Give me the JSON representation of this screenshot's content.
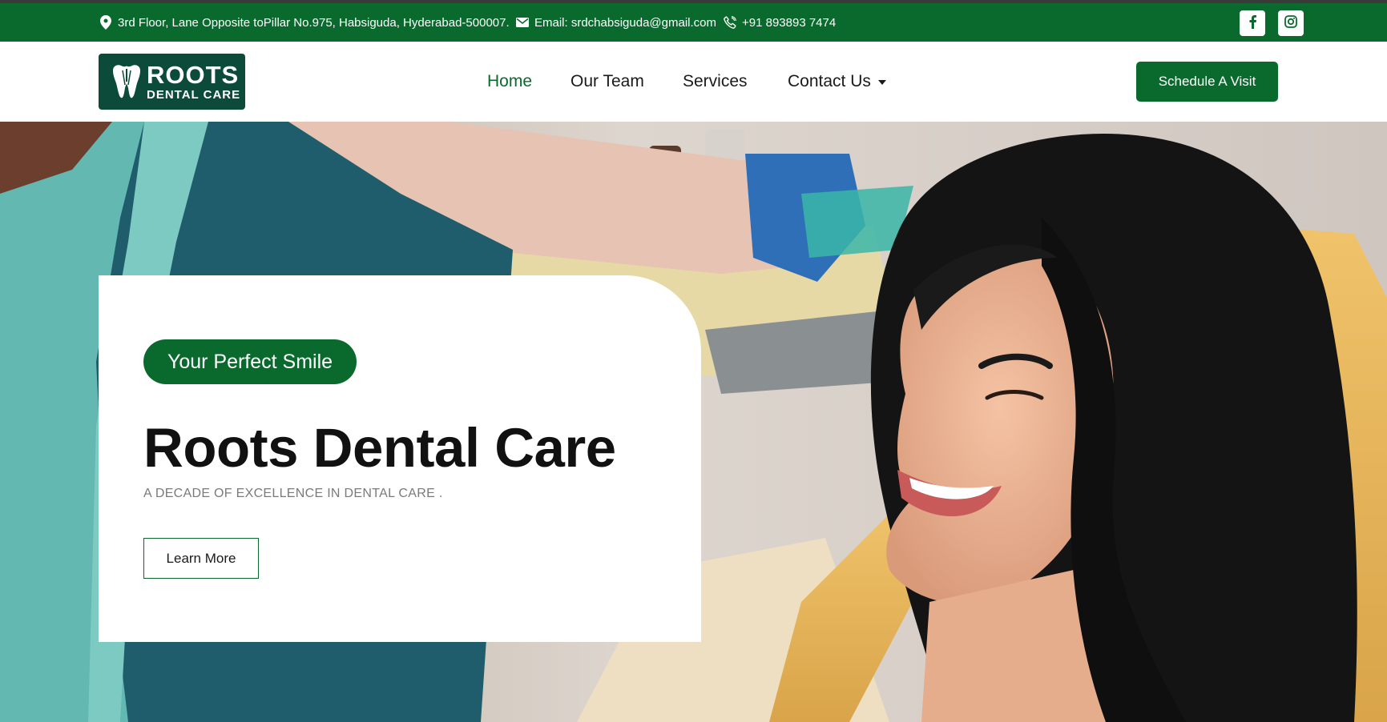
{
  "topbar": {
    "address": "3rd Floor, Lane Opposite toPillar No.975, Habsiguda, Hyderabad-500007.",
    "email": "Email: srdchabsiguda@gmail.com",
    "phone": "+91 893893 7474",
    "icons": {
      "address": "map-pin-icon",
      "email": "envelope-icon",
      "phone": "phone-icon",
      "social": [
        "facebook-icon",
        "instagram-icon"
      ]
    }
  },
  "header": {
    "logo": {
      "line1": "ROOTS",
      "line2": "DENTAL CARE"
    },
    "nav": [
      "Home",
      "Our Team",
      "Services",
      "Contact Us"
    ],
    "active_nav": "Home",
    "cta": "Schedule A Visit"
  },
  "hero": {
    "badge": "Your Perfect Smile",
    "title": "Roots Dental Care",
    "subtitle": "A DECADE OF EXCELLENCE IN DENTAL CARE .",
    "button": "Learn More"
  },
  "colors": {
    "brand_green": "#0a6a2e",
    "logo_bg": "#0c4a3a",
    "text_dark": "#111111",
    "text_muted": "#7a7a7a"
  }
}
